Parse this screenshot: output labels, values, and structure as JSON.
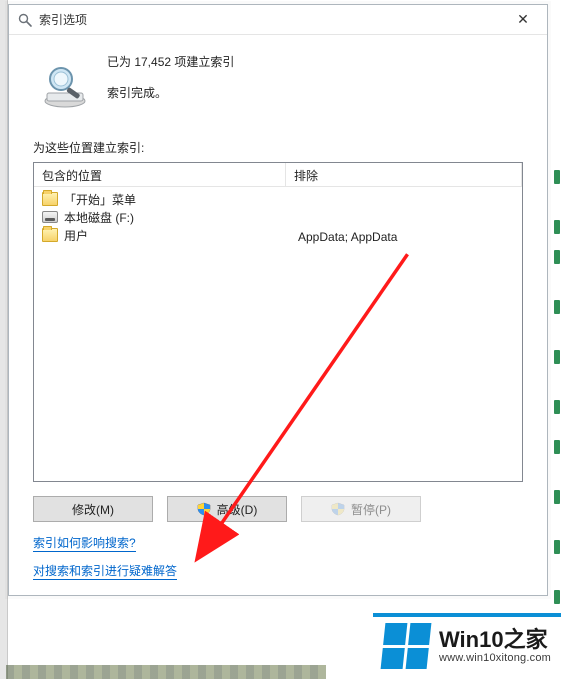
{
  "window": {
    "title": "索引选项",
    "close_label": "✕"
  },
  "status": {
    "line1": "已为 17,452 项建立索引",
    "line2": "索引完成。"
  },
  "section_label": "为这些位置建立索引:",
  "columns": {
    "included": "包含的位置",
    "excluded": "排除"
  },
  "locations": [
    {
      "icon": "folder",
      "label": "「开始」菜单",
      "exclude": ""
    },
    {
      "icon": "disk",
      "label": "本地磁盘 (F:)",
      "exclude": ""
    },
    {
      "icon": "folder",
      "label": "用户",
      "exclude": "AppData; AppData"
    }
  ],
  "buttons": {
    "modify": "修改(M)",
    "advanced": "高级(D)",
    "pause": "暂停(P)"
  },
  "links": {
    "how_affect": "索引如何影响搜索?",
    "troubleshoot": "对搜索和索引进行疑难解答"
  },
  "watermark": {
    "title": "Win10之家",
    "sub": "www.win10xitong.com"
  }
}
